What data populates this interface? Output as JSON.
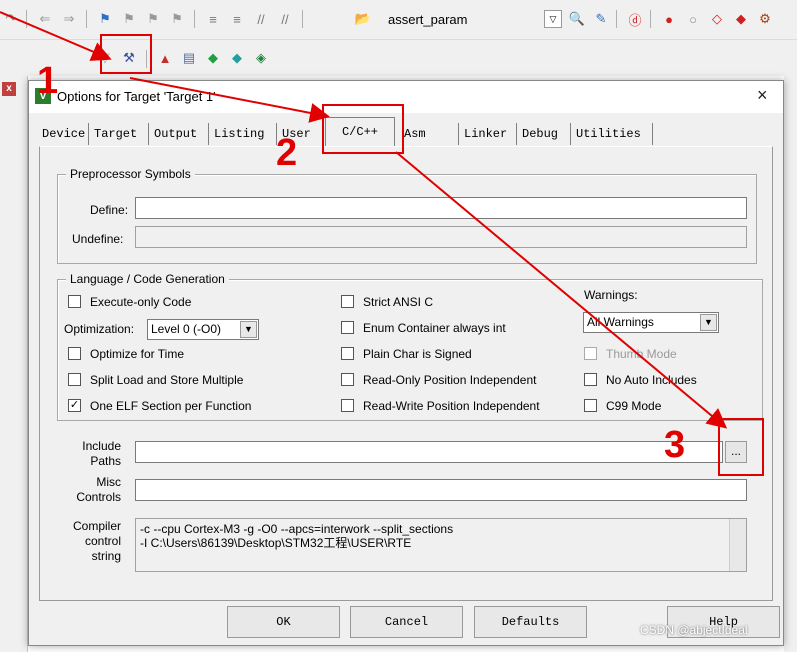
{
  "toolbar": {
    "combo_text": "assert_param"
  },
  "dialog": {
    "title": "Options for Target 'Target 1'",
    "close": "×",
    "tabs": [
      "Device",
      "Target",
      "Output",
      "Listing",
      "User",
      "C/C++",
      "Asm",
      "Linker",
      "Debug",
      "Utilities"
    ],
    "active_tab": "C/C++",
    "preprocessor": {
      "group_title": "Preprocessor Symbols",
      "define_label": "Define:",
      "define_value": "",
      "undefine_label": "Undefine:",
      "undefine_value": ""
    },
    "language": {
      "group_title": "Language / Code Generation",
      "execute_only": {
        "label": "Execute-only Code",
        "checked": false
      },
      "optimization_label": "Optimization:",
      "optimization_value": "Level 0 (-O0)",
      "optimize_time": {
        "label": "Optimize for Time",
        "checked": false
      },
      "split_load": {
        "label": "Split Load and Store Multiple",
        "checked": false
      },
      "one_elf": {
        "label": "One ELF Section per Function",
        "checked": true,
        "mark": "✓"
      },
      "strict_ansi": {
        "label": "Strict ANSI C",
        "checked": false
      },
      "enum_container": {
        "label": "Enum Container always int",
        "checked": false
      },
      "plain_char": {
        "label": "Plain Char is Signed",
        "checked": false
      },
      "ro_pi": {
        "label": "Read-Only Position Independent",
        "checked": false
      },
      "rw_pi": {
        "label": "Read-Write Position Independent",
        "checked": false
      },
      "warnings_label": "Warnings:",
      "warnings_value": "All Warnings",
      "thumb_mode": {
        "label": "Thumb Mode",
        "checked": false,
        "disabled": true
      },
      "no_auto_includes": {
        "label": "No Auto Includes",
        "checked": false
      },
      "c99_mode": {
        "label": "C99 Mode",
        "checked": false
      }
    },
    "include": {
      "label_line1": "Include",
      "label_line2": "Paths",
      "value": "",
      "browse": "..."
    },
    "misc": {
      "label_line1": "Misc",
      "label_line2": "Controls",
      "value": ""
    },
    "compiler": {
      "label_line1": "Compiler",
      "label_line2": "control",
      "label_line3": "string",
      "line1": "-c --cpu Cortex-M3 -g -O0 --apcs=interwork --split_sections",
      "line2": "-I C:\\Users\\86139\\Desktop\\STM32工程\\USER\\RTE"
    },
    "buttons": {
      "ok": "OK",
      "cancel": "Cancel",
      "defaults": "Defaults",
      "help": "Help"
    }
  },
  "annotations": {
    "n1": "1",
    "n2": "2",
    "n3": "3",
    "color": "#e00000"
  },
  "watermark": "CSDN @abjectIdeal"
}
